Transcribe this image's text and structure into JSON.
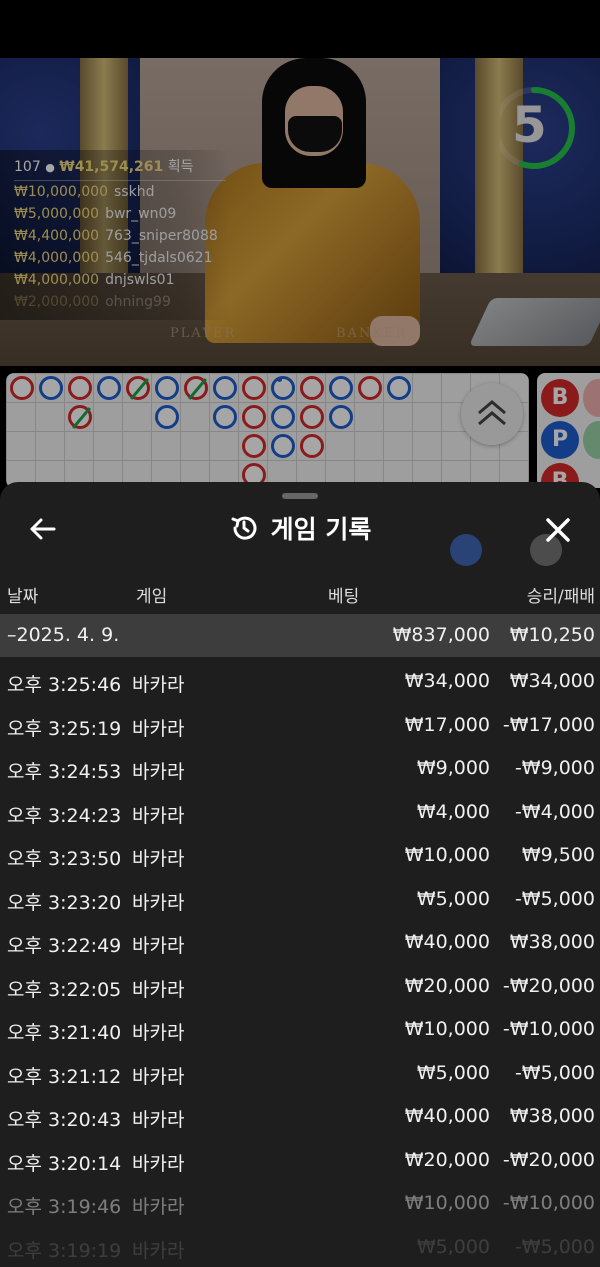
{
  "timer": {
    "value": "5",
    "progress": 0.55,
    "color": "#26c24a"
  },
  "winners": {
    "count": "107",
    "total": "₩41,574,261",
    "label": "획득",
    "rows": [
      {
        "amount": "₩10,000,000",
        "name": "sskhd"
      },
      {
        "amount": "₩5,000,000",
        "name": "bwr_wn09"
      },
      {
        "amount": "₩4,400,000",
        "name": "763_sniper8088"
      },
      {
        "amount": "₩4,000,000",
        "name": "546_tjdals0621"
      },
      {
        "amount": "₩4,000,000",
        "name": "dnjswls01"
      },
      {
        "amount": "₩2,000,000",
        "name": "ohning99"
      }
    ]
  },
  "felt": {
    "player": "PLAYER",
    "banker": "BANKER"
  },
  "bet_buttons": {
    "banker": "B",
    "player": "P",
    "tie": "B"
  },
  "history": {
    "title": "게임 기록",
    "columns": {
      "date": "날짜",
      "game": "게임",
      "bet": "베팅",
      "result": "승리/패배"
    },
    "date_group": {
      "date": "–2025. 4. 9.",
      "bet": "₩837,000",
      "result": "₩10,250"
    },
    "rows": [
      {
        "time": "오후 3:25:46",
        "game": "바카라",
        "bet": "₩34,000",
        "result": "₩34,000"
      },
      {
        "time": "오후 3:25:19",
        "game": "바카라",
        "bet": "₩17,000",
        "result": "-₩17,000"
      },
      {
        "time": "오후 3:24:53",
        "game": "바카라",
        "bet": "₩9,000",
        "result": "-₩9,000"
      },
      {
        "time": "오후 3:24:23",
        "game": "바카라",
        "bet": "₩4,000",
        "result": "-₩4,000"
      },
      {
        "time": "오후 3:23:50",
        "game": "바카라",
        "bet": "₩10,000",
        "result": "₩9,500"
      },
      {
        "time": "오후 3:23:20",
        "game": "바카라",
        "bet": "₩5,000",
        "result": "-₩5,000"
      },
      {
        "time": "오후 3:22:49",
        "game": "바카라",
        "bet": "₩40,000",
        "result": "₩38,000"
      },
      {
        "time": "오후 3:22:05",
        "game": "바카라",
        "bet": "₩20,000",
        "result": "-₩20,000"
      },
      {
        "time": "오후 3:21:40",
        "game": "바카라",
        "bet": "₩10,000",
        "result": "-₩10,000"
      },
      {
        "time": "오후 3:21:12",
        "game": "바카라",
        "bet": "₩5,000",
        "result": "-₩5,000"
      },
      {
        "time": "오후 3:20:43",
        "game": "바카라",
        "bet": "₩40,000",
        "result": "₩38,000"
      },
      {
        "time": "오후 3:20:14",
        "game": "바카라",
        "bet": "₩20,000",
        "result": "-₩20,000"
      },
      {
        "time": "오후 3:19:46",
        "game": "바카라",
        "bet": "₩10,000",
        "result": "-₩10,000"
      },
      {
        "time": "오후 3:19:19",
        "game": "바카라",
        "bet": "₩5,000",
        "result": "-₩5,000"
      }
    ]
  },
  "road": {
    "banker_color": "#d62a2a",
    "player_color": "#1f5fd1",
    "tie_color": "#1aa44a",
    "columns": [
      [
        "B"
      ],
      [
        "P"
      ],
      [
        "B",
        "B"
      ],
      [
        "P"
      ],
      [
        "B"
      ],
      [
        "P",
        "P"
      ],
      [
        "B"
      ],
      [
        "P",
        "P"
      ],
      [
        "B",
        "B",
        "B",
        "B"
      ],
      [
        "P",
        "P",
        "P"
      ],
      [
        "B",
        "B",
        "B"
      ],
      [
        "P",
        "P"
      ],
      [
        "B"
      ],
      [
        "P"
      ]
    ]
  }
}
